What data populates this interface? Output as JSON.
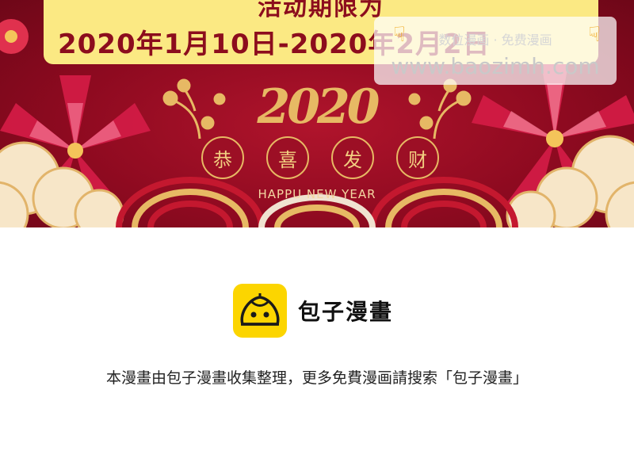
{
  "banner": {
    "title_partial": "活动期限为",
    "date_range": "2020年1月10日-2020年2月2日",
    "year_art": "2020",
    "blessings": [
      "恭",
      "喜",
      "发",
      "财"
    ],
    "greeting": "HAPPU NEW YEAR",
    "colors": {
      "background": "#8e0a20",
      "gold": "#e7b964",
      "date_box": "#fbe983",
      "date_text": "#8c0d1d"
    }
  },
  "watermark": {
    "small_text": "数位漫画 · 免费漫画",
    "url": "www.baozimh.com",
    "hand_icon": "pointing-down-hand-icon"
  },
  "brand": {
    "name": "包子漫畫",
    "logo_icon": "steamed-bun-face-icon",
    "logo_color": "#fcd500"
  },
  "footer": {
    "note": "本漫畫由包子漫畫收集整理，更多免費漫画請搜索「包子漫畫」"
  }
}
